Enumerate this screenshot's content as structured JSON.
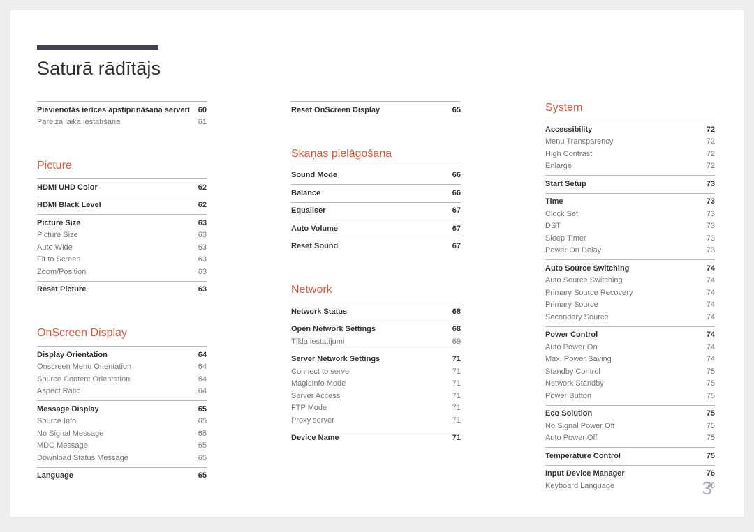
{
  "document": {
    "title": "Saturā rādītājs",
    "page_number": "3",
    "accent_color": "#d25a3e",
    "title_rule_color": "#474354",
    "page_number_color": "#a7abbd"
  },
  "columns": [
    {
      "name": "column-left",
      "sections": [
        {
          "heading": null,
          "groups": [
            {
              "entries": [
                {
                  "label": "Pievienotās ierīces apstiprināšana serverī",
                  "page": "60",
                  "level": "main"
                },
                {
                  "label": "Pareiza laika iestatīšana",
                  "page": "61",
                  "level": "sub"
                }
              ]
            }
          ]
        },
        {
          "heading": "Picture",
          "groups": [
            {
              "entries": [
                {
                  "label": "HDMI UHD Color",
                  "page": "62",
                  "level": "main"
                }
              ]
            },
            {
              "entries": [
                {
                  "label": "HDMI Black Level",
                  "page": "62",
                  "level": "main"
                }
              ]
            },
            {
              "entries": [
                {
                  "label": "Picture Size",
                  "page": "63",
                  "level": "main"
                },
                {
                  "label": "Picture Size",
                  "page": "63",
                  "level": "sub"
                },
                {
                  "label": "Auto Wide",
                  "page": "63",
                  "level": "sub"
                },
                {
                  "label": "Fit to Screen",
                  "page": "63",
                  "level": "sub"
                },
                {
                  "label": "Zoom/Position",
                  "page": "63",
                  "level": "sub"
                }
              ]
            },
            {
              "entries": [
                {
                  "label": "Reset Picture",
                  "page": "63",
                  "level": "main"
                }
              ]
            }
          ]
        },
        {
          "heading": "OnScreen Display",
          "groups": [
            {
              "entries": [
                {
                  "label": "Display Orientation",
                  "page": "64",
                  "level": "main"
                },
                {
                  "label": "Onscreen Menu Orientation",
                  "page": "64",
                  "level": "sub"
                },
                {
                  "label": "Source Content Orientation",
                  "page": "64",
                  "level": "sub"
                },
                {
                  "label": "Aspect Ratio",
                  "page": "64",
                  "level": "sub"
                }
              ]
            },
            {
              "entries": [
                {
                  "label": "Message Display",
                  "page": "65",
                  "level": "main"
                },
                {
                  "label": "Source Info",
                  "page": "65",
                  "level": "sub"
                },
                {
                  "label": "No Signal Message",
                  "page": "65",
                  "level": "sub"
                },
                {
                  "label": "MDC Message",
                  "page": "65",
                  "level": "sub"
                },
                {
                  "label": "Download Status Message",
                  "page": "65",
                  "level": "sub"
                }
              ]
            },
            {
              "entries": [
                {
                  "label": "Language",
                  "page": "65",
                  "level": "main"
                }
              ]
            }
          ]
        }
      ]
    },
    {
      "name": "column-middle",
      "sections": [
        {
          "heading": null,
          "groups": [
            {
              "entries": [
                {
                  "label": "Reset OnScreen Display",
                  "page": "65",
                  "level": "main"
                }
              ]
            }
          ]
        },
        {
          "heading": "Skaņas pielāgošana",
          "groups": [
            {
              "entries": [
                {
                  "label": "Sound Mode",
                  "page": "66",
                  "level": "main"
                }
              ]
            },
            {
              "entries": [
                {
                  "label": "Balance",
                  "page": "66",
                  "level": "main"
                }
              ]
            },
            {
              "entries": [
                {
                  "label": "Equaliser",
                  "page": "67",
                  "level": "main"
                }
              ]
            },
            {
              "entries": [
                {
                  "label": "Auto Volume",
                  "page": "67",
                  "level": "main"
                }
              ]
            },
            {
              "entries": [
                {
                  "label": "Reset Sound",
                  "page": "67",
                  "level": "main"
                }
              ]
            }
          ]
        },
        {
          "heading": "Network",
          "groups": [
            {
              "entries": [
                {
                  "label": "Network Status",
                  "page": "68",
                  "level": "main"
                }
              ]
            },
            {
              "entries": [
                {
                  "label": "Open Network Settings",
                  "page": "68",
                  "level": "main"
                },
                {
                  "label": "Tīkla iestatījumi",
                  "page": "69",
                  "level": "sub"
                }
              ]
            },
            {
              "entries": [
                {
                  "label": "Server Network Settings",
                  "page": "71",
                  "level": "main"
                },
                {
                  "label": "Connect to server",
                  "page": "71",
                  "level": "sub"
                },
                {
                  "label": "MagicInfo Mode",
                  "page": "71",
                  "level": "sub"
                },
                {
                  "label": "Server Access",
                  "page": "71",
                  "level": "sub"
                },
                {
                  "label": "FTP Mode",
                  "page": "71",
                  "level": "sub"
                },
                {
                  "label": "Proxy server",
                  "page": "71",
                  "level": "sub"
                }
              ]
            },
            {
              "entries": [
                {
                  "label": "Device Name",
                  "page": "71",
                  "level": "main"
                }
              ]
            }
          ]
        }
      ]
    },
    {
      "name": "column-right",
      "sections": [
        {
          "heading": "System",
          "groups": [
            {
              "entries": [
                {
                  "label": "Accessibility",
                  "page": "72",
                  "level": "main"
                },
                {
                  "label": "Menu Transparency",
                  "page": "72",
                  "level": "sub"
                },
                {
                  "label": "High Contrast",
                  "page": "72",
                  "level": "sub"
                },
                {
                  "label": "Enlarge",
                  "page": "72",
                  "level": "sub"
                }
              ]
            },
            {
              "entries": [
                {
                  "label": "Start Setup",
                  "page": "73",
                  "level": "main"
                }
              ]
            },
            {
              "entries": [
                {
                  "label": "Time",
                  "page": "73",
                  "level": "main"
                },
                {
                  "label": "Clock Set",
                  "page": "73",
                  "level": "sub"
                },
                {
                  "label": "DST",
                  "page": "73",
                  "level": "sub"
                },
                {
                  "label": "Sleep Timer",
                  "page": "73",
                  "level": "sub"
                },
                {
                  "label": "Power On Delay",
                  "page": "73",
                  "level": "sub"
                }
              ]
            },
            {
              "entries": [
                {
                  "label": "Auto Source Switching",
                  "page": "74",
                  "level": "main"
                },
                {
                  "label": "Auto Source Switching",
                  "page": "74",
                  "level": "sub"
                },
                {
                  "label": "Primary Source Recovery",
                  "page": "74",
                  "level": "sub"
                },
                {
                  "label": "Primary Source",
                  "page": "74",
                  "level": "sub"
                },
                {
                  "label": "Secondary Source",
                  "page": "74",
                  "level": "sub"
                }
              ]
            },
            {
              "entries": [
                {
                  "label": "Power Control",
                  "page": "74",
                  "level": "main"
                },
                {
                  "label": "Auto Power On",
                  "page": "74",
                  "level": "sub"
                },
                {
                  "label": "Max. Power Saving",
                  "page": "74",
                  "level": "sub"
                },
                {
                  "label": "Standby Control",
                  "page": "75",
                  "level": "sub"
                },
                {
                  "label": "Network Standby",
                  "page": "75",
                  "level": "sub"
                },
                {
                  "label": "Power Button",
                  "page": "75",
                  "level": "sub"
                }
              ]
            },
            {
              "entries": [
                {
                  "label": "Eco Solution",
                  "page": "75",
                  "level": "main"
                },
                {
                  "label": "No Signal Power Off",
                  "page": "75",
                  "level": "sub"
                },
                {
                  "label": "Auto Power Off",
                  "page": "75",
                  "level": "sub"
                }
              ]
            },
            {
              "entries": [
                {
                  "label": "Temperature Control",
                  "page": "75",
                  "level": "main"
                }
              ]
            },
            {
              "entries": [
                {
                  "label": "Input Device Manager",
                  "page": "76",
                  "level": "main"
                },
                {
                  "label": "Keyboard Language",
                  "page": "76",
                  "level": "sub"
                }
              ]
            }
          ]
        }
      ]
    }
  ]
}
